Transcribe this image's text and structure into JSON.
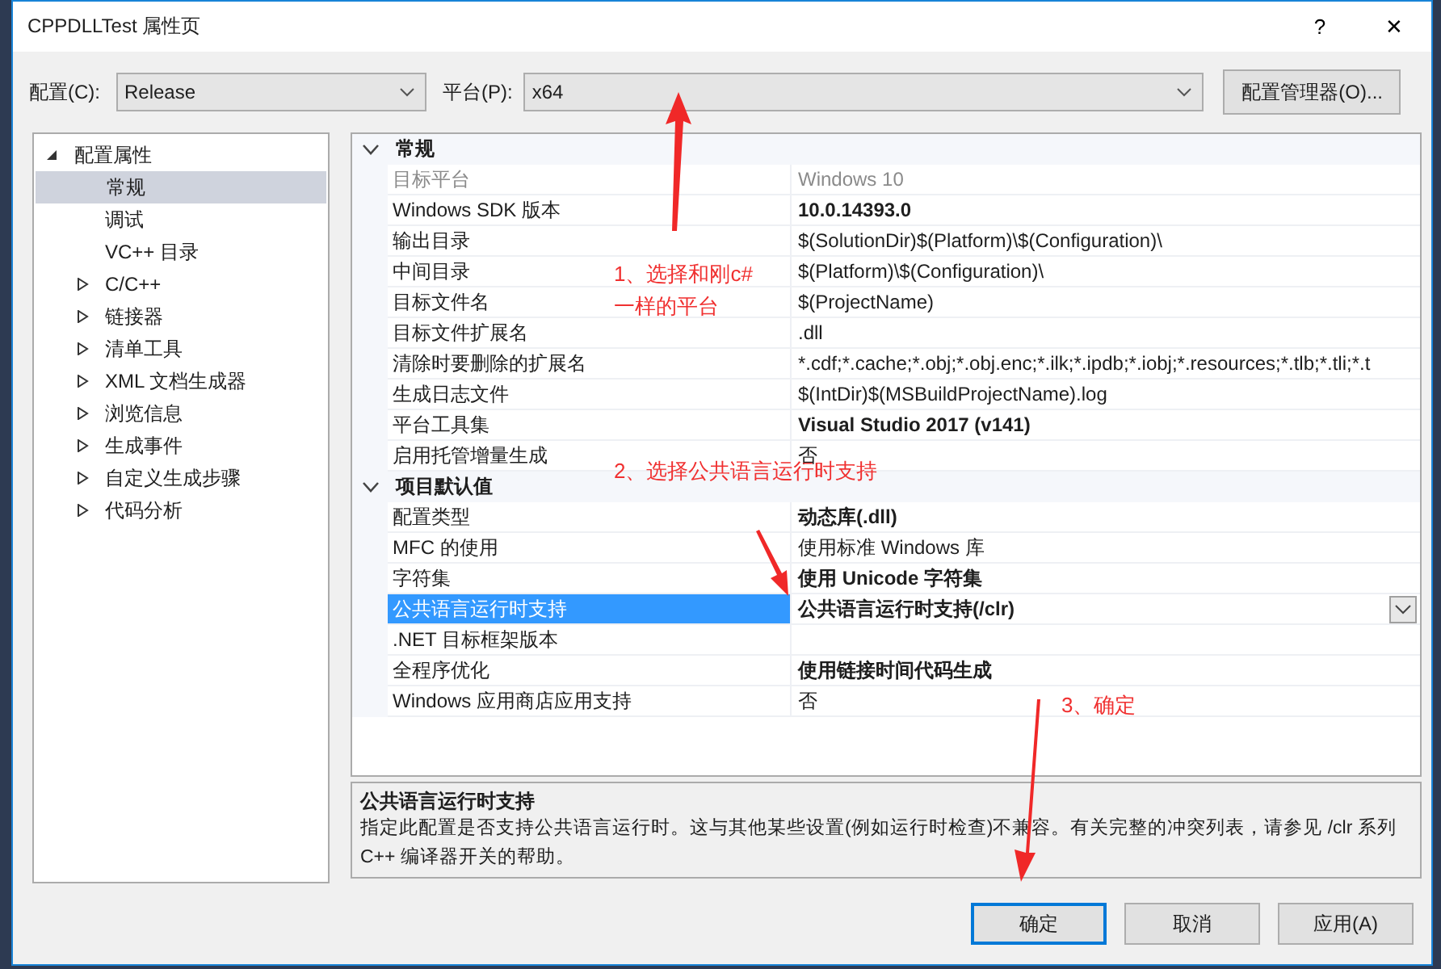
{
  "window": {
    "title": "CPPDLLTest 属性页",
    "help": "?",
    "close": "✕"
  },
  "toolbar": {
    "config_label": "配置(C):",
    "config_value": "Release",
    "platform_label": "平台(P):",
    "platform_value": "x64",
    "manager_button": "配置管理器(O)..."
  },
  "tree": [
    {
      "label": "配置属性",
      "kind": "group",
      "expanded": true,
      "selected": false,
      "children": [
        {
          "label": "常规",
          "kind": "leaf",
          "selected": true
        },
        {
          "label": "调试",
          "kind": "leaf",
          "selected": false
        },
        {
          "label": "VC++ 目录",
          "kind": "leaf",
          "selected": false
        },
        {
          "label": "C/C++",
          "kind": "group",
          "expanded": false,
          "selected": false
        },
        {
          "label": "链接器",
          "kind": "group",
          "expanded": false,
          "selected": false
        },
        {
          "label": "清单工具",
          "kind": "group",
          "expanded": false,
          "selected": false
        },
        {
          "label": "XML 文档生成器",
          "kind": "group",
          "expanded": false,
          "selected": false
        },
        {
          "label": "浏览信息",
          "kind": "group",
          "expanded": false,
          "selected": false
        },
        {
          "label": "生成事件",
          "kind": "group",
          "expanded": false,
          "selected": false
        },
        {
          "label": "自定义生成步骤",
          "kind": "group",
          "expanded": false,
          "selected": false
        },
        {
          "label": "代码分析",
          "kind": "group",
          "expanded": false,
          "selected": false
        }
      ]
    }
  ],
  "grid": [
    {
      "name": "常规",
      "expanded": true,
      "rows": [
        {
          "name": "目标平台",
          "value": "Windows 10",
          "bold": false,
          "disabled": true,
          "selected": false
        },
        {
          "name": "Windows SDK 版本",
          "value": "10.0.14393.0",
          "bold": true,
          "disabled": false,
          "selected": false
        },
        {
          "name": "输出目录",
          "value": "$(SolutionDir)$(Platform)\\$(Configuration)\\",
          "bold": false,
          "disabled": false,
          "selected": false
        },
        {
          "name": "中间目录",
          "value": "$(Platform)\\$(Configuration)\\",
          "bold": false,
          "disabled": false,
          "selected": false
        },
        {
          "name": "目标文件名",
          "value": "$(ProjectName)",
          "bold": false,
          "disabled": false,
          "selected": false
        },
        {
          "name": "目标文件扩展名",
          "value": ".dll",
          "bold": false,
          "disabled": false,
          "selected": false
        },
        {
          "name": "清除时要删除的扩展名",
          "value": "*.cdf;*.cache;*.obj;*.obj.enc;*.ilk;*.ipdb;*.iobj;*.resources;*.tlb;*.tli;*.t",
          "bold": false,
          "disabled": false,
          "selected": false
        },
        {
          "name": "生成日志文件",
          "value": "$(IntDir)$(MSBuildProjectName).log",
          "bold": false,
          "disabled": false,
          "selected": false
        },
        {
          "name": "平台工具集",
          "value": "Visual Studio 2017 (v141)",
          "bold": true,
          "disabled": false,
          "selected": false
        },
        {
          "name": "启用托管增量生成",
          "value": "否",
          "bold": false,
          "disabled": false,
          "selected": false
        }
      ]
    },
    {
      "name": "项目默认值",
      "expanded": true,
      "rows": [
        {
          "name": "配置类型",
          "value": "动态库(.dll)",
          "bold": true,
          "disabled": false,
          "selected": false
        },
        {
          "name": "MFC 的使用",
          "value": "使用标准 Windows 库",
          "bold": false,
          "disabled": false,
          "selected": false
        },
        {
          "name": "字符集",
          "value": "使用 Unicode 字符集",
          "bold": true,
          "disabled": false,
          "selected": false
        },
        {
          "name": "公共语言运行时支持",
          "value": "公共语言运行时支持(/clr)",
          "bold": true,
          "disabled": false,
          "selected": true
        },
        {
          "name": ".NET 目标框架版本",
          "value": "",
          "bold": false,
          "disabled": false,
          "selected": false
        },
        {
          "name": "全程序优化",
          "value": "使用链接时间代码生成",
          "bold": true,
          "disabled": false,
          "selected": false
        },
        {
          "name": "Windows 应用商店应用支持",
          "value": "否",
          "bold": false,
          "disabled": false,
          "selected": false
        }
      ]
    }
  ],
  "description": {
    "title": "公共语言运行时支持",
    "text": "指定此配置是否支持公共语言运行时。这与其他某些设置(例如运行时检查)不兼容。有关完整的冲突列表，请参见 /clr 系列 C++ 编译器开关的帮助。"
  },
  "buttons": [
    {
      "label": "确定",
      "default": true
    },
    {
      "label": "取消",
      "default": false
    },
    {
      "label": "应用(A)",
      "default": false
    }
  ],
  "annotations": [
    {
      "text": "1、选择和刚c#\n一样的平台"
    },
    {
      "text": "2、选择公共语言运行时支持"
    },
    {
      "text": "3、确定"
    }
  ]
}
